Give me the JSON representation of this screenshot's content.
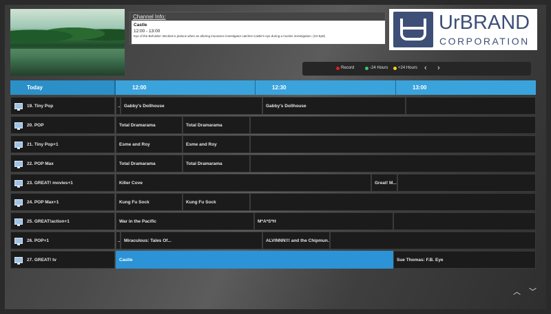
{
  "channel_info": {
    "title": "Channel Info:",
    "program_name": "Castle",
    "time": "12:00 - 13:00",
    "description": "Eye of the Beholder: Beckett is jealous when an alluring insurance investigator catches Castle's eye during a murder investigation. (S4 Ep9)"
  },
  "logo": {
    "brand": "UrBRAND",
    "corporation": "CORPORATION"
  },
  "controls": {
    "record": "Record",
    "minus24": "-24 Hours",
    "plus24": "+24 Hours",
    "prev": "‹",
    "next": "›"
  },
  "colors": {
    "record": "#e02020",
    "minus24": "#3ec46d",
    "plus24": "#f0d020",
    "header_blue": "#3aa3dc",
    "selected_blue": "#2b93d6",
    "logo_navy": "#3d4f77"
  },
  "header": {
    "today": "Today",
    "times": [
      "12:00",
      "12:30",
      "13:00"
    ]
  },
  "rows": [
    {
      "channel": "19. Tiny Pop",
      "programs": [
        "..",
        "Gabby's Dollhouse",
        "Gabby's Dollhouse",
        ""
      ]
    },
    {
      "channel": "20. POP",
      "programs": [
        "Total Dramarama",
        "Total Dramarama",
        ""
      ]
    },
    {
      "channel": "21. Tiny Pop+1",
      "programs": [
        "Esme and Roy",
        "Esme and Roy",
        ""
      ]
    },
    {
      "channel": "22. POP Max",
      "programs": [
        "Total Dramarama",
        "Total Dramarama",
        ""
      ]
    },
    {
      "channel": "23. GREAT! movies+1",
      "programs": [
        "Killer Cove",
        "Great! M...",
        ""
      ]
    },
    {
      "channel": "24. POP Max+1",
      "programs": [
        "Kung Fu Sock",
        "Kung Fu Sock",
        ""
      ]
    },
    {
      "channel": "25. GREAT!action+1",
      "programs": [
        "War in the Pacific",
        "M*A*S*H",
        ""
      ]
    },
    {
      "channel": "26. POP+1",
      "programs": [
        "..",
        "Miraculous: Tales Of...",
        "ALVINNN!!! and the Chipmun...",
        ""
      ]
    },
    {
      "channel": "27. GREAT! tv",
      "programs": [
        "Castle",
        "Sue Thomas: F.B. Eye"
      ]
    }
  ],
  "scroll": {
    "up": "︿",
    "down": "﹀"
  }
}
